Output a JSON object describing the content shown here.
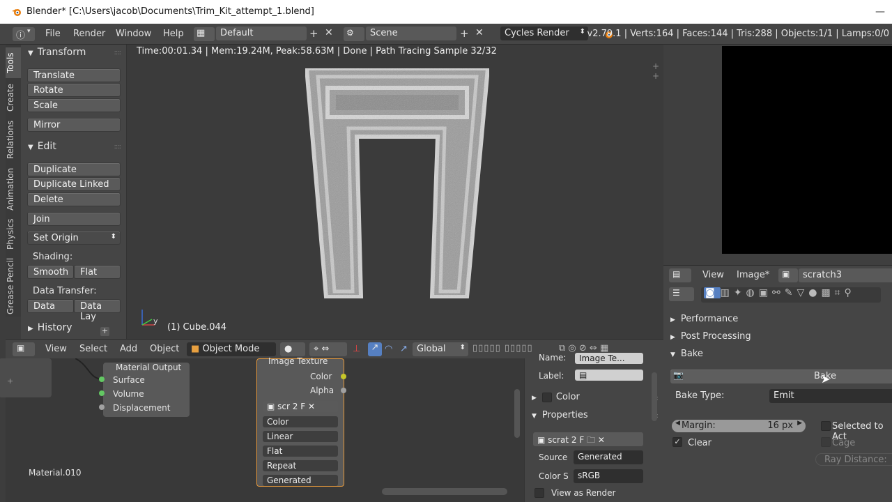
{
  "window": {
    "title": "Blender* [C:\\Users\\jacob\\Documents\\Trim_Kit_attempt_1.blend]",
    "minimize": "—"
  },
  "header": {
    "menus": [
      "File",
      "Render",
      "Window",
      "Help"
    ],
    "layout": "Default",
    "scene": "Scene",
    "engine": "Cycles Render",
    "stats": "v2.79.1 | Verts:164 | Faces:144 | Tris:288 | Objects:1/1 | Lamps:0/0"
  },
  "tabs": [
    "Tools",
    "Create",
    "Relations",
    "Animation",
    "Physics",
    "Grease Pencil"
  ],
  "toolshelf": {
    "transform": {
      "title": "Transform",
      "buttons": [
        "Translate",
        "Rotate",
        "Scale"
      ],
      "mirror": "Mirror"
    },
    "edit": {
      "title": "Edit",
      "buttons": [
        "Duplicate",
        "Duplicate Linked",
        "Delete"
      ],
      "join": "Join",
      "set_origin": "Set Origin"
    },
    "shading": {
      "label": "Shading:",
      "smooth": "Smooth",
      "flat": "Flat"
    },
    "data_transfer": {
      "label": "Data Transfer:",
      "data": "Data",
      "data_lay": "Data Lay"
    },
    "history": "History"
  },
  "viewport": {
    "info": "Time:00:01.34 | Mem:19.24M, Peak:58.63M | Done | Path Tracing Sample 32/32",
    "object": "(1) Cube.044",
    "axis_y": "y"
  },
  "view_header": {
    "menus": [
      "View",
      "Select",
      "Add",
      "Object"
    ],
    "mode": "Object Mode",
    "orientation": "Global"
  },
  "node_editor": {
    "material_output": {
      "title": "Material Output",
      "sockets": [
        "Surface",
        "Volume",
        "Displacement"
      ]
    },
    "image_texture": {
      "title": "Image Texture",
      "outputs": [
        "Color",
        "Alpha"
      ],
      "image_name": "scr",
      "users": "2",
      "fake": "F",
      "dropdowns": [
        "Color",
        "Linear",
        "Flat",
        "Repeat",
        "Generated"
      ]
    },
    "material": "Material.010"
  },
  "node_props": {
    "name_label": "Name:",
    "name_value": "Image Te...",
    "label_label": "Label:",
    "color_panel": "Color",
    "properties_panel": "Properties",
    "image_name": "scrat",
    "users": "2",
    "fake": "F",
    "source_label": "Source",
    "source_value": "Generated",
    "colorspace_label": "Color S",
    "colorspace_value": "sRGB",
    "view_as_render": "View as Render"
  },
  "image_editor": {
    "menus": [
      "View",
      "Image*"
    ],
    "image": "scratch3"
  },
  "properties": {
    "panels": [
      "Performance",
      "Post Processing",
      "Bake"
    ],
    "bake_button": "Bake",
    "bake_type_label": "Bake Type:",
    "bake_type_value": "Emit",
    "margin_label": "Margin:",
    "margin_value": "16 px",
    "clear": "Clear",
    "selected_to_active": "Selected to Act",
    "cage": "Cage",
    "ray_distance": "Ray Distance:"
  },
  "colors": {
    "accent": "#5680c2",
    "socket_yellow": "#c7c729",
    "socket_green": "#63c763",
    "socket_gray": "#a1a1a1"
  }
}
